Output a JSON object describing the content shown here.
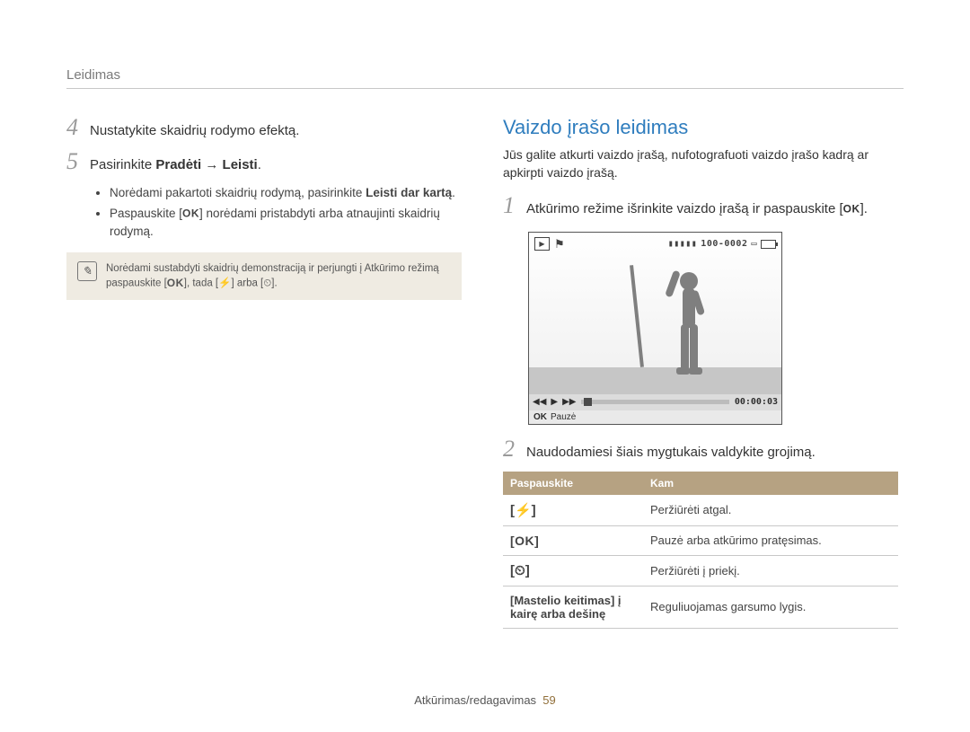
{
  "header": {
    "breadcrumb": "Leidimas"
  },
  "left": {
    "step4_num": "4",
    "step4_text": "Nustatykite skaidrių rodymo efektą.",
    "step5_num": "5",
    "step5_prefix": "Pasirinkite ",
    "step5_bold": "Pradėti → Leisti",
    "step5_suffix": ".",
    "bullet1_a": "Norėdami pakartoti skaidrių rodymą, pasirinkite ",
    "bullet1_b": "Leisti dar kartą",
    "bullet1_c": ".",
    "bullet2_a": "Paspauskite [",
    "bullet2_ok": "OK",
    "bullet2_b": "] norėdami pristabdyti arba atnaujinti skaidrių rodymą.",
    "note": "Norėdami sustabdyti skaidrių demonstraciją ir perjungti į Atkūrimo režimą paspauskite [",
    "note_ok": "OK",
    "note_mid": "], tada [",
    "note_flash": "⚡",
    "note_mid2": "] arba [",
    "note_timer": "⏲",
    "note_end": "]."
  },
  "right": {
    "title": "Vaizdo įrašo leidimas",
    "intro": "Jūs galite atkurti vaizdo įrašą, nufotografuoti vaizdo įrašo kadrą ar apkirpti vaizdo įrašą.",
    "step1_num": "1",
    "step1_a": "Atkūrimo režime išrinkite vaizdo įrašą ir paspauskite [",
    "step1_ok": "OK",
    "step1_b": "].",
    "screen": {
      "counter": "100-0002",
      "time": "00:00:03",
      "ok": "OK",
      "pause": "Pauzė"
    },
    "step2_num": "2",
    "step2_text": "Naudodamiesi šiais mygtukais valdykite grojimą.",
    "table": {
      "h1": "Paspauskite",
      "h2": "Kam",
      "rows": [
        {
          "btn": "[⚡]",
          "desc": "Peržiūrėti atgal."
        },
        {
          "btn": "[OK]",
          "desc": "Pauzė arba atkūrimo pratęsimas."
        },
        {
          "btn": "[⏲]",
          "desc": "Peržiūrėti į priekį."
        },
        {
          "btn": "[Mastelio keitimas] į kairę arba dešinę",
          "desc": "Reguliuojamas garsumo lygis."
        }
      ]
    }
  },
  "footer": {
    "text": "Atkūrimas/redagavimas",
    "page": "59"
  }
}
